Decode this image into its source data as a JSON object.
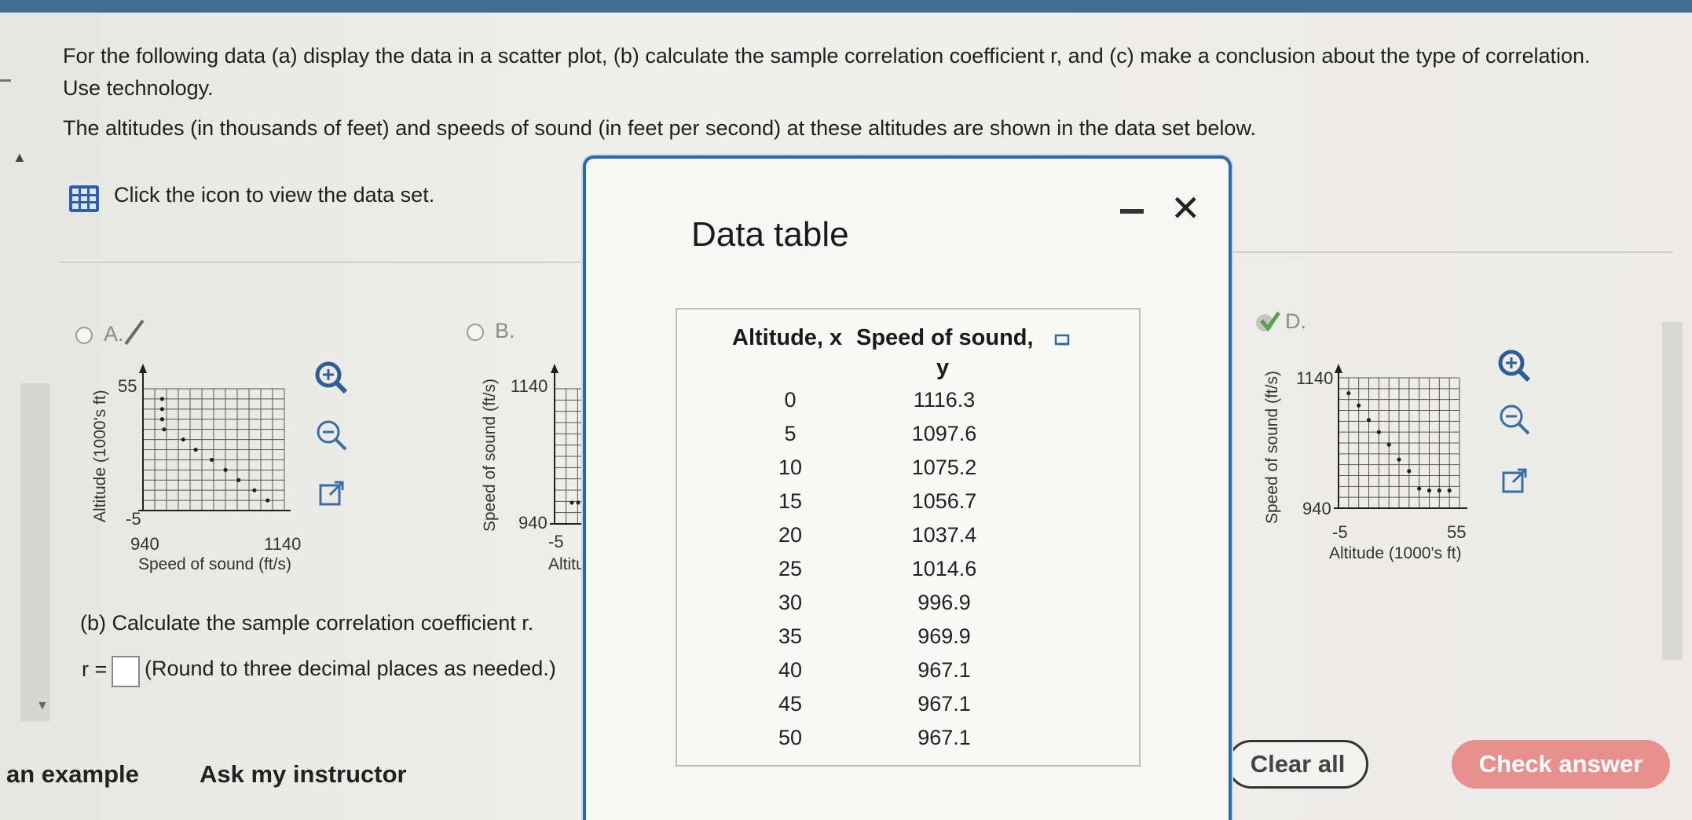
{
  "question": {
    "line1": "For the following data (a) display the data in a scatter plot, (b) calculate the sample correlation coefficient r, and (c) make a conclusion about the type of correlation.",
    "line2": "Use technology.",
    "context": "The altitudes (in thousands of feet) and speeds of sound (in feet per second) at these altitudes are shown in the data set below.",
    "dataset_link": "Click the icon to view the data set."
  },
  "options": {
    "a": {
      "label": "A.",
      "xlabel": "Speed of sound (ft/s)",
      "ylabel": "Altitude (1000's ft)",
      "x_ticks": [
        "940",
        "1140"
      ],
      "y_ticks": [
        "55",
        "-5"
      ]
    },
    "b": {
      "label": "B.",
      "ylabel": "Speed of sound (ft/s)",
      "xlabel_partial": "Altitu",
      "y_ticks": [
        "1140",
        "940"
      ],
      "x_ticks": [
        "-5"
      ]
    },
    "d": {
      "label": "D.",
      "ylabel": "Speed of sound (ft/s)",
      "xlabel": "Altitude (1000's ft)",
      "y_ticks": [
        "1140",
        "940"
      ],
      "x_ticks": [
        "-5",
        "55"
      ]
    }
  },
  "part_b": {
    "prompt": "(b) Calculate the sample correlation coefficient r.",
    "r_label": "r =",
    "r_value": "",
    "hint": "(Round to three decimal places as needed.)"
  },
  "modal": {
    "title": "Data table",
    "col_x": "Altitude, x",
    "col_y_line1": "Speed of sound,",
    "col_y_line2": "y"
  },
  "table": [
    {
      "x": "0",
      "y": "1116.3"
    },
    {
      "x": "5",
      "y": "1097.6"
    },
    {
      "x": "10",
      "y": "1075.2"
    },
    {
      "x": "15",
      "y": "1056.7"
    },
    {
      "x": "20",
      "y": "1037.4"
    },
    {
      "x": "25",
      "y": "1014.6"
    },
    {
      "x": "30",
      "y": "996.9"
    },
    {
      "x": "35",
      "y": "969.9"
    },
    {
      "x": "40",
      "y": "967.1"
    },
    {
      "x": "45",
      "y": "967.1"
    },
    {
      "x": "50",
      "y": "967.1"
    }
  ],
  "footer": {
    "example": "an example",
    "instructor": "Ask my instructor",
    "clear": "Clear all",
    "check": "Check answer"
  },
  "colors": {
    "modal_border": "#2a6aa8",
    "check_button": "#e88f8f",
    "grid_icon": "#2e5fa8",
    "selected_check": "#5aa04a"
  },
  "icons": [
    "grid-icon",
    "zoom-in-icon",
    "zoom-out-icon",
    "external-link-icon",
    "close-icon",
    "minimize-icon",
    "copy-icon"
  ]
}
